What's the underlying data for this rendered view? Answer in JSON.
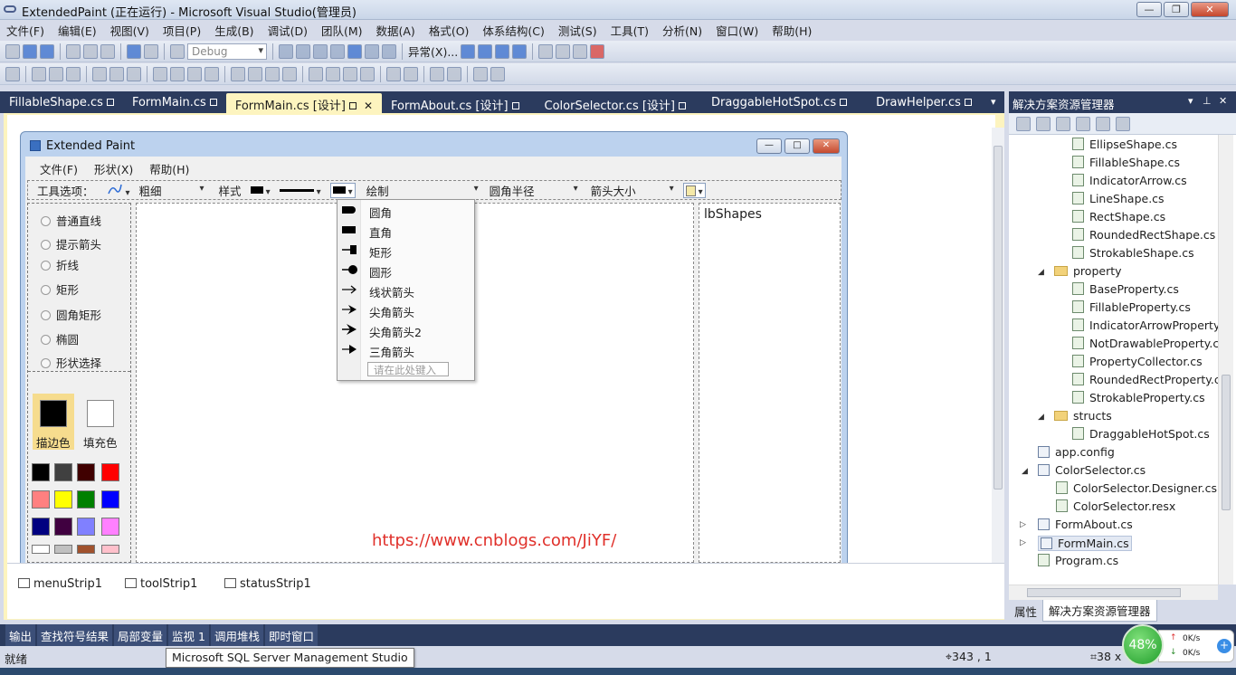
{
  "app": {
    "title": "ExtendedPaint (正在运行) - Microsoft Visual Studio(管理员)",
    "window_buttons": [
      "—",
      "❐",
      "✕"
    ]
  },
  "menubar": [
    "文件(F)",
    "编辑(E)",
    "视图(V)",
    "项目(P)",
    "生成(B)",
    "调试(D)",
    "团队(M)",
    "数据(A)",
    "格式(O)",
    "体系结构(C)",
    "测试(S)",
    "工具(T)",
    "分析(N)",
    "窗口(W)",
    "帮助(H)"
  ],
  "toolbar": {
    "config_combo": "Debug",
    "exception_label": "异常(X)..."
  },
  "doc_tabs": [
    {
      "label": "FillableShape.cs",
      "active": false
    },
    {
      "label": "FormMain.cs",
      "active": false
    },
    {
      "label": "FormMain.cs [设计]",
      "active": true
    },
    {
      "label": "FormAbout.cs [设计]",
      "active": false
    },
    {
      "label": "ColorSelector.cs [设计]",
      "active": false
    },
    {
      "label": "DraggableHotSpot.cs",
      "active": false
    },
    {
      "label": "DrawHelper.cs",
      "active": false
    }
  ],
  "form": {
    "title": "Extended Paint",
    "menu": [
      "文件(F)",
      "形状(X)",
      "帮助(H)"
    ],
    "toolstrip": {
      "label": "工具选项：",
      "thickness": "粗细",
      "style": "样式",
      "draw": "绘制",
      "corner_radius": "圆角半径",
      "arrow_size": "箭头大小"
    },
    "shape_radios": [
      "普通直线",
      "提示箭头",
      "折线",
      "矩形",
      "圆角矩形",
      "椭圆",
      "形状选择"
    ],
    "stroke_color_label": "描边色",
    "fill_color_label": "填充色",
    "palette": [
      "#000000",
      "#404040",
      "#400000",
      "#ff0000",
      "#ff8080",
      "#ffff00",
      "#008000",
      "#0000ff",
      "#000080",
      "#400040",
      "#8080ff",
      "#ff80ff",
      "#ffffff",
      "#c0c0c0",
      "#a0522d",
      "#ffc0cb"
    ],
    "listbox_text": "lbShapes",
    "dropdown": {
      "items": [
        "圆角",
        "直角",
        "矩形",
        "圆形",
        "线状箭头",
        "尖角箭头",
        "尖角箭头2",
        "三角箭头"
      ],
      "input_placeholder": "请在此处键入"
    }
  },
  "watermark": "https://www.cnblogs.com/JiYF/",
  "component_tray": [
    "menuStrip1",
    "toolStrip1",
    "statusStrip1"
  ],
  "solution_explorer": {
    "title": "解决方案资源管理器",
    "header_buttons": [
      "▾",
      "⊥",
      "✕"
    ],
    "nodes": [
      {
        "label": "EllipseShape.cs",
        "kind": "file"
      },
      {
        "label": "FillableShape.cs",
        "kind": "file"
      },
      {
        "label": "IndicatorArrow.cs",
        "kind": "file"
      },
      {
        "label": "LineShape.cs",
        "kind": "file"
      },
      {
        "label": "RectShape.cs",
        "kind": "file"
      },
      {
        "label": "RoundedRectShape.cs",
        "kind": "file"
      },
      {
        "label": "StrokableShape.cs",
        "kind": "file"
      },
      {
        "label": "property",
        "kind": "folder"
      },
      {
        "label": "BaseProperty.cs",
        "kind": "file"
      },
      {
        "label": "FillableProperty.cs",
        "kind": "file"
      },
      {
        "label": "IndicatorArrowProperty",
        "kind": "file"
      },
      {
        "label": "NotDrawableProperty.c",
        "kind": "file"
      },
      {
        "label": "PropertyCollector.cs",
        "kind": "file"
      },
      {
        "label": "RoundedRectProperty.c",
        "kind": "file"
      },
      {
        "label": "StrokableProperty.cs",
        "kind": "file"
      },
      {
        "label": "structs",
        "kind": "folder"
      },
      {
        "label": "DraggableHotSpot.cs",
        "kind": "file"
      },
      {
        "label": "app.config",
        "kind": "config"
      },
      {
        "label": "ColorSelector.cs",
        "kind": "form"
      },
      {
        "label": "ColorSelector.Designer.cs",
        "kind": "file"
      },
      {
        "label": "ColorSelector.resx",
        "kind": "file"
      },
      {
        "label": "FormAbout.cs",
        "kind": "form"
      },
      {
        "label": "FormMain.cs",
        "kind": "form"
      },
      {
        "label": "Program.cs",
        "kind": "file"
      }
    ],
    "bottom_tabs": [
      "属性",
      "解决方案资源管理器"
    ]
  },
  "bottom_tool_tabs": [
    "输出",
    "查找符号结果",
    "局部变量",
    "监视 1",
    "调用堆栈",
    "即时窗口"
  ],
  "status": {
    "ready": "就绪",
    "position": "343 , 1",
    "size": "38 x",
    "tooltip": "Microsoft SQL Server Management Studio"
  },
  "net_widget": {
    "percent": "48%",
    "up": "0K/s",
    "down": "0K/s"
  }
}
